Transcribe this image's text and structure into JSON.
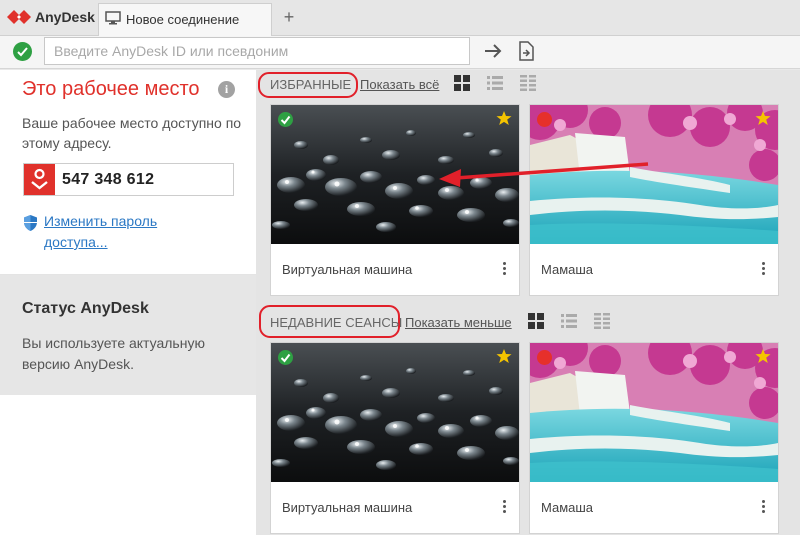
{
  "titlebar": {
    "app_name": "AnyDesk",
    "tab_label": "Новое соединение",
    "new_tab_label": "+"
  },
  "addressbar": {
    "placeholder": "Введите AnyDesk ID или псевдоним"
  },
  "workplace": {
    "title": "Это рабочее место",
    "info_label": "i",
    "description": "Ваше рабочее место доступно по этому адресу.",
    "id": "547 348 612",
    "change_password": "Изменить пароль доступа..."
  },
  "status": {
    "title": "Статус AnyDesk",
    "description": "Вы используете актуальную версию AnyDesk."
  },
  "favorites": {
    "label": "ИЗБРАННЫЕ",
    "link": "Показать всё",
    "cards": [
      {
        "name": "Виртуальная машина",
        "online": true,
        "starred": true,
        "thumbnail": "dark-water-droplets"
      },
      {
        "name": "Мамаша",
        "online": false,
        "starred": true,
        "thumbnail": "waterfall-pink-trees"
      }
    ]
  },
  "recent": {
    "label": "НЕДАВНИЕ СЕАНСЫ",
    "link": "Показать меньше",
    "cards": [
      {
        "name": "Виртуальная машина",
        "online": true,
        "starred": true,
        "thumbnail": "dark-water-droplets"
      },
      {
        "name": "Мамаша",
        "online": false,
        "starred": true,
        "thumbnail": "waterfall-pink-trees"
      }
    ]
  },
  "colors": {
    "brand_red": "#e0312b",
    "online_green": "#2ea043",
    "offline_red": "#e6302b",
    "star_yellow": "#f5c400",
    "link_blue": "#2b78c4",
    "annotation_red": "#e1202a"
  },
  "icons": [
    "anydesk-logo-icon",
    "monitor-icon",
    "check-icon",
    "arrow-right-icon",
    "file-transfer-icon",
    "info-icon",
    "id-badge-icon",
    "shield-icon",
    "grid-view-icon",
    "list-view-icon",
    "compact-list-icon",
    "star-icon",
    "more-vertical-icon"
  ]
}
